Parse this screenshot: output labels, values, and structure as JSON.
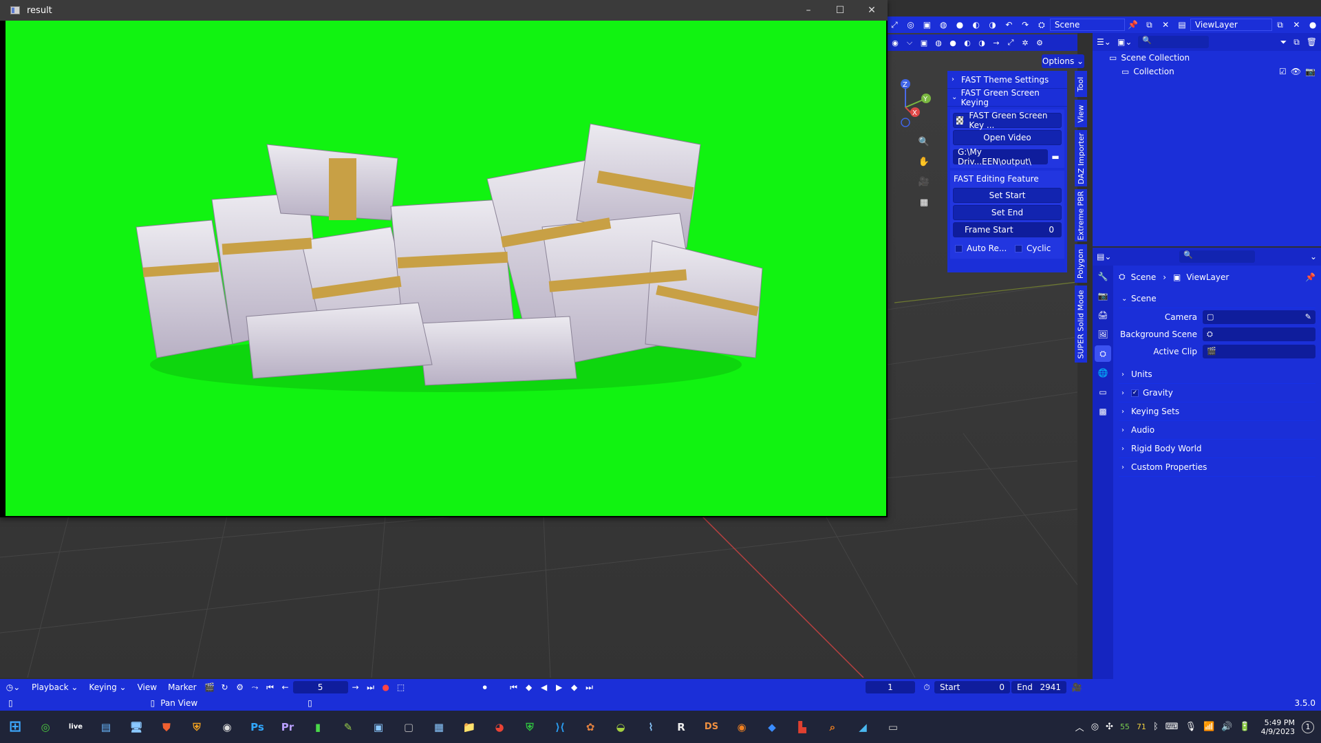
{
  "result_window": {
    "title": "result",
    "minimize": "–",
    "maximize": "☐",
    "close": "✕"
  },
  "top_header": {
    "scene_name": "Scene",
    "view_layer_name": "ViewLayer"
  },
  "viewport": {
    "options_label": "Options"
  },
  "vertical_tabs": [
    "Tool",
    "View",
    "DAZ Importer",
    "Extreme PBR",
    "Polygon",
    "SUPER Solid Mode"
  ],
  "npanel": {
    "theme_settings_label": "FAST Theme Settings",
    "green_screen_label": "FAST Green Screen Keying",
    "green_screen_key_button": "FAST Green Screen Key ...",
    "open_video_button": "Open Video",
    "output_path": "G:\\My Driv...EEN\\output\\",
    "editing_feature_label": "FAST Editing Feature",
    "set_start_button": "Set Start",
    "set_end_button": "Set End",
    "frame_start_label": "Frame Start",
    "frame_start_value": "0",
    "auto_re_label": "Auto Re...",
    "cyclic_label": "Cyclic"
  },
  "outliner": {
    "scene_collection": "Scene Collection",
    "collection": "Collection"
  },
  "properties": {
    "breadcrumb_scene": "Scene",
    "breadcrumb_view_layer": "ViewLayer",
    "scene_panel": "Scene",
    "camera_label": "Camera",
    "background_scene_label": "Background Scene",
    "active_clip_label": "Active Clip",
    "sub_panels": [
      "Units",
      "Gravity",
      "Keying Sets",
      "Audio",
      "Rigid Body World",
      "Custom Properties"
    ]
  },
  "timeline": {
    "playback": "Playback",
    "keying": "Keying",
    "view": "View",
    "marker": "Marker",
    "current_frame": "5",
    "frame_display": "1",
    "start_label": "Start",
    "start_value": "0",
    "end_label": "End",
    "end_value": "2941"
  },
  "statusbar": {
    "pan_view": "Pan View",
    "version": "3.5.0"
  },
  "taskbar": {
    "time": "5:49 PM",
    "date": "4/9/2023",
    "notification_count": "1",
    "apps": [
      "start",
      "blender",
      "live",
      "notes",
      "remote",
      "brave",
      "shield",
      "obs",
      "Ps",
      "Pr",
      "chart",
      "editor",
      "monitor",
      "blank",
      "files",
      "folder",
      "chrome",
      "defender",
      "vscode",
      "krita",
      "android",
      "graph",
      "R",
      "DS",
      "blender2",
      "diamond",
      "acrobat",
      "search",
      "sketch",
      "terminal"
    ]
  },
  "colors": {
    "accent": "#1b2fd8",
    "green_screen": "#11f311",
    "viewport_bg": "#3a3a3a",
    "taskbar_bg": "#1f2438"
  }
}
